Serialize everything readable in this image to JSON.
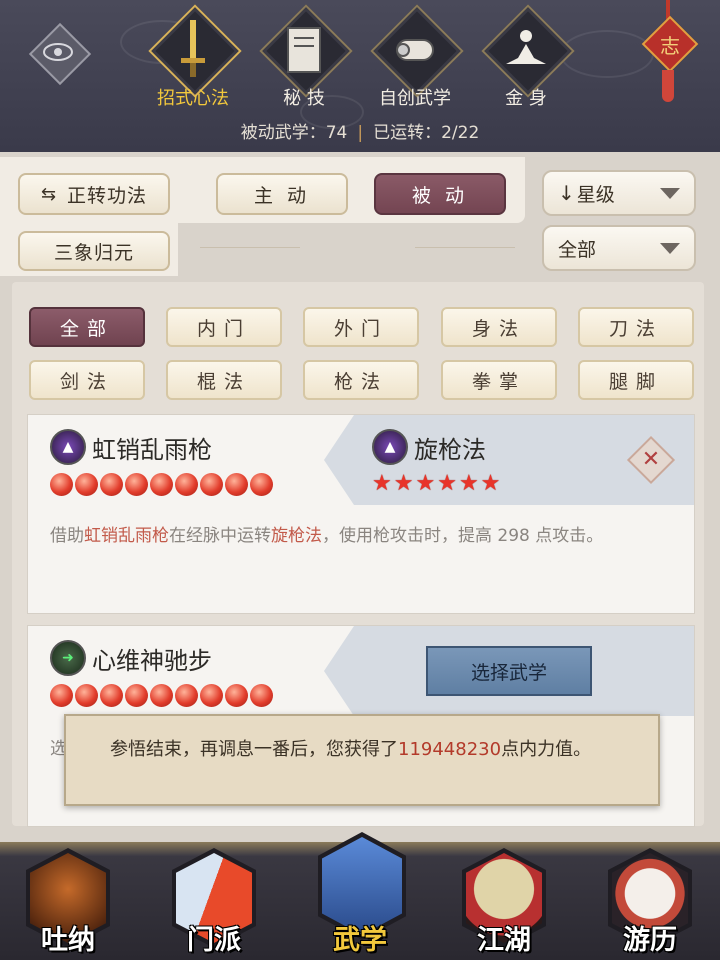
{
  "header": {
    "tabs": [
      {
        "label": "招式心法",
        "icon": "sword-icon",
        "active": true
      },
      {
        "label": "秘 技",
        "icon": "book-icon",
        "active": false
      },
      {
        "label": "自创武学",
        "icon": "scroll-icon",
        "active": false
      },
      {
        "label": "金 身",
        "icon": "meditation-icon",
        "active": false
      }
    ],
    "stats_passive_label": "被动武学：",
    "stats_passive_value": "74",
    "stats_running_label": "已运转：",
    "stats_running_value": "2/22",
    "charm_label": "志"
  },
  "filters": {
    "rotate_label": "正转功法",
    "active_label": "主 动",
    "passive_label": "被 动",
    "sanxiang_label": "三象归元",
    "sort_label": "星级",
    "scope_label": "全部"
  },
  "categories": [
    "全部",
    "内门",
    "外门",
    "身法",
    "刀法",
    "剑法",
    "棍法",
    "枪法",
    "拳掌",
    "腿脚"
  ],
  "card1": {
    "left_name": "虹销乱雨枪",
    "flames": 9,
    "right_name": "旋枪法",
    "stars": 6,
    "desc_prefix": "借助",
    "desc_skill1": "虹销乱雨枪",
    "desc_mid": "在经脉中运转",
    "desc_skill2": "旋枪法",
    "desc_suffix": "，使用枪攻击时，提高 298 点攻击。"
  },
  "card2": {
    "left_name": "心维神驰步",
    "flames": 9,
    "button_label": "选择武学",
    "hidden_text": "选"
  },
  "toast": {
    "prefix": "参悟结束，再调息一番后，您获得了",
    "number": "119448230",
    "suffix": "点内力值。"
  },
  "bottom_nav": [
    {
      "label": "吐纳",
      "icon": "monk-icon",
      "active": false
    },
    {
      "label": "门派",
      "icon": "banner-icon",
      "active": false
    },
    {
      "label": "武学",
      "icon": "manual-icon",
      "active": true
    },
    {
      "label": "江湖",
      "icon": "straw-hat-icon",
      "active": false
    },
    {
      "label": "游历",
      "icon": "horse-icon",
      "active": false
    }
  ],
  "colors": {
    "accent_active": "#744552",
    "gold_text": "#f2c83c",
    "highlight_red": "#c25a4a",
    "button_blue": "#5f7fa3"
  }
}
